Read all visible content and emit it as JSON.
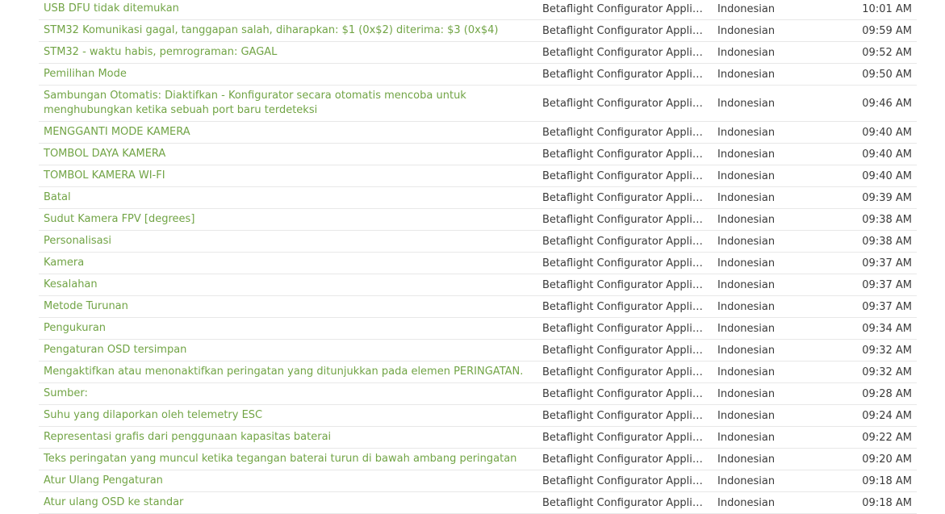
{
  "colors": {
    "link": "#71a445",
    "text": "#3a3a3a",
    "divider": "#e8e8e8"
  },
  "rows": [
    {
      "string": "USB DFU tidak ditemukan",
      "project": "Betaflight Configurator Applicati...",
      "language": "Indonesian",
      "time": "10:01 AM"
    },
    {
      "string": "STM32 Komunikasi gagal, tanggapan salah, diharapkan: $1 (0x$2) diterima: $3 (0x$4)",
      "project": "Betaflight Configurator Applicati...",
      "language": "Indonesian",
      "time": "09:59 AM"
    },
    {
      "string": "STM32 - waktu habis, pemrograman: GAGAL",
      "project": "Betaflight Configurator Applicati...",
      "language": "Indonesian",
      "time": "09:52 AM"
    },
    {
      "string": "Pemilihan Mode",
      "project": "Betaflight Configurator Applicati...",
      "language": "Indonesian",
      "time": "09:50 AM"
    },
    {
      "string": "Sambungan Otomatis: Diaktifkan - Konfigurator secara otomatis mencoba untuk menghubungkan ketika sebuah port baru terdeteksi",
      "project": "Betaflight Configurator Applicati...",
      "language": "Indonesian",
      "time": "09:46 AM"
    },
    {
      "string": "MENGGANTI MODE KAMERA",
      "project": "Betaflight Configurator Applicati...",
      "language": "Indonesian",
      "time": "09:40 AM"
    },
    {
      "string": "TOMBOL DAYA KAMERA",
      "project": "Betaflight Configurator Applicati...",
      "language": "Indonesian",
      "time": "09:40 AM"
    },
    {
      "string": "TOMBOL KAMERA WI-FI",
      "project": "Betaflight Configurator Applicati...",
      "language": "Indonesian",
      "time": "09:40 AM"
    },
    {
      "string": "Batal",
      "project": "Betaflight Configurator Applicati...",
      "language": "Indonesian",
      "time": "09:39 AM"
    },
    {
      "string": "Sudut Kamera FPV [degrees]",
      "project": "Betaflight Configurator Applicati...",
      "language": "Indonesian",
      "time": "09:38 AM"
    },
    {
      "string": "Personalisasi",
      "project": "Betaflight Configurator Applicati...",
      "language": "Indonesian",
      "time": "09:38 AM"
    },
    {
      "string": "Kamera",
      "project": "Betaflight Configurator Applicati...",
      "language": "Indonesian",
      "time": "09:37 AM"
    },
    {
      "string": "Kesalahan",
      "project": "Betaflight Configurator Applicati...",
      "language": "Indonesian",
      "time": "09:37 AM"
    },
    {
      "string": "Metode Turunan",
      "project": "Betaflight Configurator Applicati...",
      "language": "Indonesian",
      "time": "09:37 AM"
    },
    {
      "string": "Pengukuran",
      "project": "Betaflight Configurator Applicati...",
      "language": "Indonesian",
      "time": "09:34 AM"
    },
    {
      "string": "Pengaturan OSD tersimpan",
      "project": "Betaflight Configurator Applicati...",
      "language": "Indonesian",
      "time": "09:32 AM"
    },
    {
      "string": "Mengaktifkan atau menonaktifkan peringatan yang ditunjukkan pada elemen PERINGATAN.",
      "project": "Betaflight Configurator Applicati...",
      "language": "Indonesian",
      "time": "09:32 AM"
    },
    {
      "string": "Sumber:",
      "project": "Betaflight Configurator Applicati...",
      "language": "Indonesian",
      "time": "09:28 AM"
    },
    {
      "string": "Suhu yang dilaporkan oleh telemetry ESC",
      "project": "Betaflight Configurator Applicati...",
      "language": "Indonesian",
      "time": "09:24 AM"
    },
    {
      "string": "Representasi grafis dari penggunaan kapasitas baterai",
      "project": "Betaflight Configurator Applicati...",
      "language": "Indonesian",
      "time": "09:22 AM"
    },
    {
      "string": "Teks peringatan yang muncul ketika tegangan baterai turun di bawah ambang peringatan",
      "project": "Betaflight Configurator Applicati...",
      "language": "Indonesian",
      "time": "09:20 AM"
    },
    {
      "string": "Atur Ulang Pengaturan",
      "project": "Betaflight Configurator Applicati...",
      "language": "Indonesian",
      "time": "09:18 AM"
    },
    {
      "string": "Atur ulang OSD ke standar",
      "project": "Betaflight Configurator Applicati...",
      "language": "Indonesian",
      "time": "09:18 AM"
    }
  ]
}
